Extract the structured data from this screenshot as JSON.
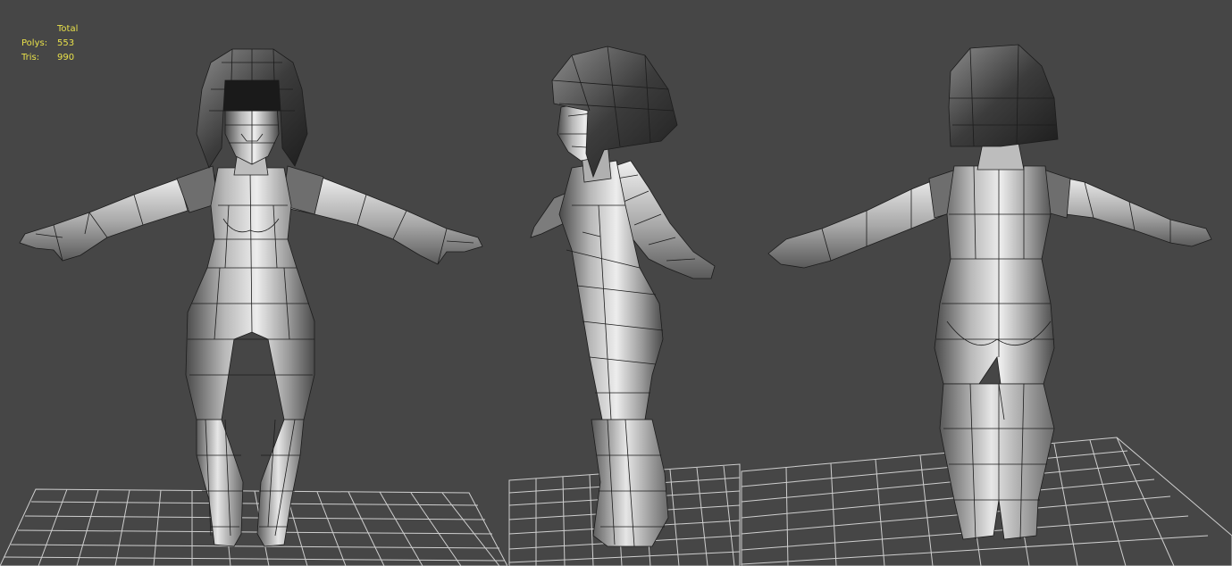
{
  "stats": {
    "header": "Total",
    "rows": [
      {
        "label": "Polys:",
        "value": "553"
      },
      {
        "label": "Tris:",
        "value": "990"
      }
    ]
  },
  "views": [
    {
      "name": "front"
    },
    {
      "name": "side"
    },
    {
      "name": "back"
    }
  ],
  "colors": {
    "background": "#464646",
    "stats_text": "#e8e04a",
    "wire": "#1c1c1c",
    "grid": "#d8d8d8",
    "mesh_light": "#dcdcdc",
    "mesh_dark": "#3a3a3a"
  }
}
